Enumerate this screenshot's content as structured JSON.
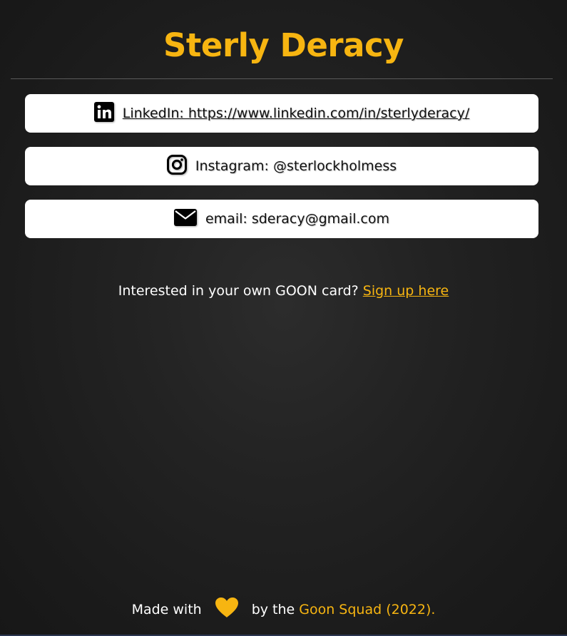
{
  "profile": {
    "name": "Sterly Deracy"
  },
  "links": [
    {
      "icon": "linkedin-icon",
      "label": "LinkedIn: https://www.linkedin.com/in/sterlyderacy/"
    },
    {
      "icon": "instagram-icon",
      "label": "Instagram: @sterlockholmess"
    },
    {
      "icon": "mail-icon",
      "label": "email: sderacy@gmail.com"
    }
  ],
  "signup": {
    "prompt": "Interested in your own GOON card?",
    "link_label": "Sign up here"
  },
  "footer": {
    "made_with": "Made with",
    "by_the": "by the",
    "squad": "Goon Squad (2022)."
  },
  "colors": {
    "accent": "#f7b511",
    "background": "#1e1e1e",
    "card": "#ffffff"
  }
}
